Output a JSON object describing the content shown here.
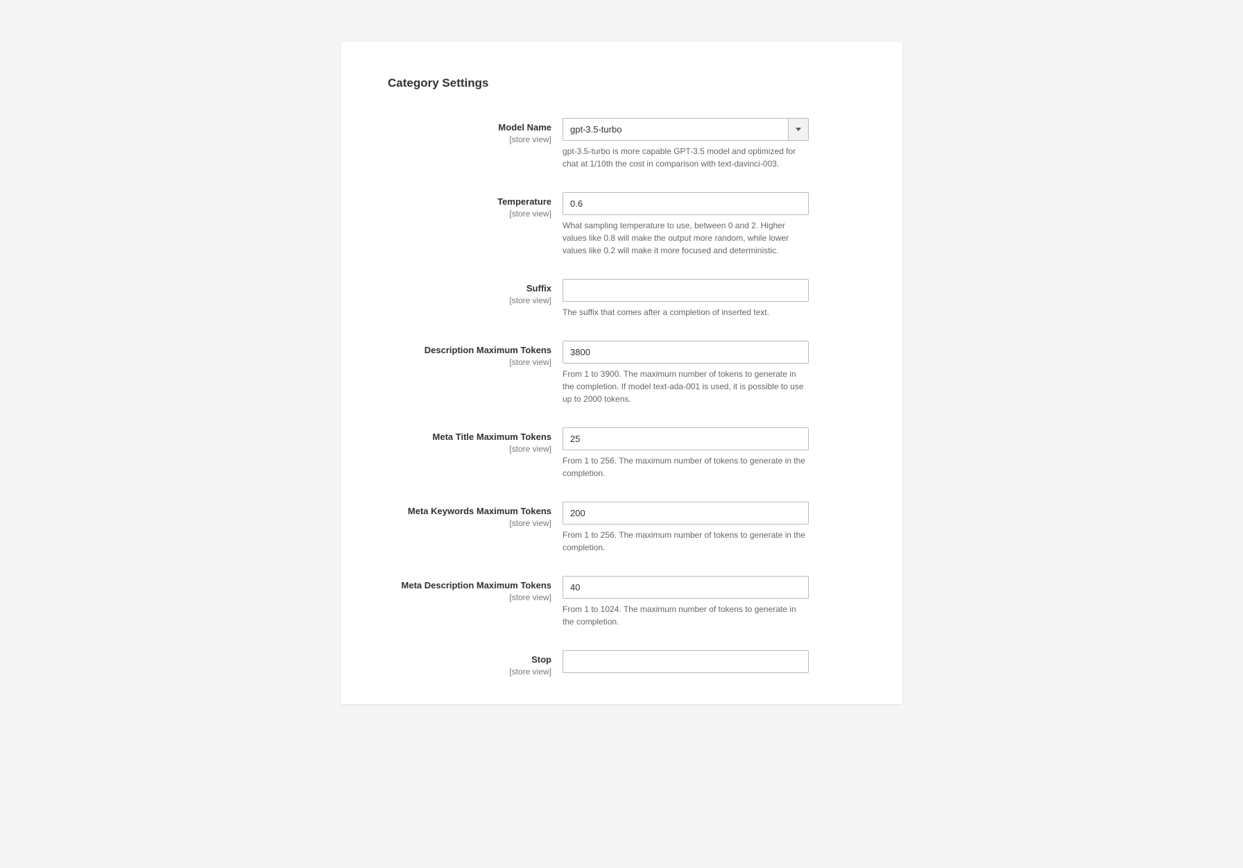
{
  "section": {
    "title": "Category Settings"
  },
  "fields": {
    "model_name": {
      "label": "Model Name",
      "scope": "[store view]",
      "value": "gpt-3.5-turbo",
      "help": "gpt-3.5-turbo is more capable GPT-3.5 model and optimized for chat at 1/10th the cost in comparison with text-davinci-003."
    },
    "temperature": {
      "label": "Temperature",
      "scope": "[store view]",
      "value": "0.6",
      "help": "What sampling temperature to use, between 0 and 2. Higher values like 0.8 will make the output more random, while lower values like 0.2 will make it more focused and deterministic."
    },
    "suffix": {
      "label": "Suffix",
      "scope": "[store view]",
      "value": "",
      "help": "The suffix that comes after a completion of inserted text."
    },
    "description_max_tokens": {
      "label": "Description Maximum Tokens",
      "scope": "[store view]",
      "value": "3800",
      "help": "From 1 to 3900. The maximum number of tokens to generate in the completion. If model text-ada-001 is used, it is possible to use up to 2000 tokens."
    },
    "meta_title_max_tokens": {
      "label": "Meta Title Maximum Tokens",
      "scope": "[store view]",
      "value": "25",
      "help": "From 1 to 256. The maximum number of tokens to generate in the completion."
    },
    "meta_keywords_max_tokens": {
      "label": "Meta Keywords Maximum Tokens",
      "scope": "[store view]",
      "value": "200",
      "help": "From 1 to 256. The maximum number of tokens to generate in the completion."
    },
    "meta_description_max_tokens": {
      "label": "Meta Description Maximum Tokens",
      "scope": "[store view]",
      "value": "40",
      "help": "From 1 to 1024. The maximum number of tokens to generate in the completion."
    },
    "stop": {
      "label": "Stop",
      "scope": "[store view]",
      "value": ""
    }
  }
}
